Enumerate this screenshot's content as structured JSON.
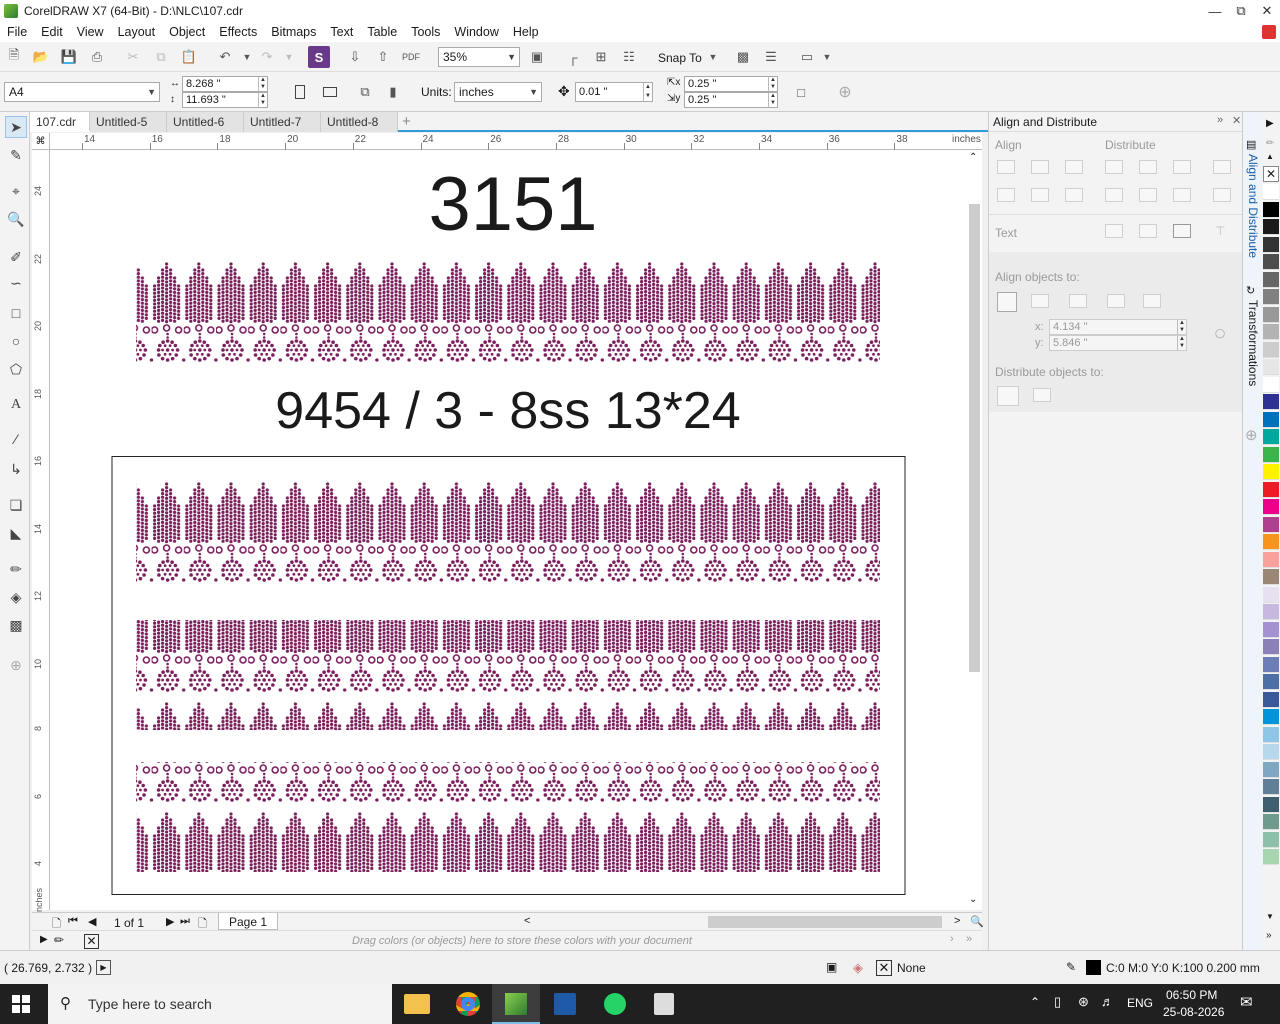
{
  "window": {
    "title": "CorelDRAW X7 (64-Bit) - D:\\NLC\\107.cdr"
  },
  "menu": [
    "File",
    "Edit",
    "View",
    "Layout",
    "Object",
    "Effects",
    "Bitmaps",
    "Text",
    "Table",
    "Tools",
    "Window",
    "Help"
  ],
  "toolbar": {
    "zoom": "35%",
    "snap_to": "Snap To"
  },
  "propbar": {
    "page_size": "A4",
    "width": "8.268 \"",
    "height": "11.693 \"",
    "units_label": "Units:",
    "units": "inches",
    "nudge": "0.01 \"",
    "dup_x": "0.25 \"",
    "dup_y": "0.25 \""
  },
  "doc_tabs": [
    "107.cdr",
    "Untitled-5",
    "Untitled-6",
    "Untitled-7",
    "Untitled-8"
  ],
  "ruler": {
    "h_ticks": [
      "14",
      "16",
      "18",
      "20",
      "22",
      "24",
      "26",
      "28",
      "30",
      "32",
      "34",
      "36",
      "38"
    ],
    "h_unit": "inches",
    "v_ticks": [
      "24",
      "22",
      "20",
      "18",
      "16",
      "14",
      "12",
      "10",
      "8",
      "6",
      "4"
    ],
    "v_unit": "inches"
  },
  "canvas": {
    "heading1": "3151",
    "heading2": "9454 / 3 - 8ss 13*24",
    "pattern_color": "#7a1f5c"
  },
  "pages": {
    "count": "1 of 1",
    "current_tab": "Page 1"
  },
  "palette_hint": "Drag colors (or objects) here to store these colors with your document",
  "docker": {
    "title": "Align and Distribute",
    "align": "Align",
    "distribute": "Distribute",
    "text": "Text",
    "align_objects_to": "Align objects to:",
    "x_label": "x:",
    "x_value": "4.134 \"",
    "y_label": "y:",
    "y_value": "5.846 \"",
    "distribute_objects_to": "Distribute objects to:"
  },
  "vtabs": [
    "Align and Distribute",
    "Transformations"
  ],
  "color_palette": [
    "#ffffff",
    "#000000",
    "#1a1a1a",
    "#333333",
    "#4d4d4d",
    "#666666",
    "#808080",
    "#999999",
    "#b3b3b3",
    "#cccccc",
    "#e6e6e6",
    "#ffffff",
    "#2e3192",
    "#0071bc",
    "#00a99d",
    "#39b54a",
    "#fff200",
    "#ed1c24",
    "#ec008c",
    "#b0408f",
    "#f7941d",
    "#f9a19a",
    "#998675",
    "#e6e0f0",
    "#c7b8e0",
    "#a491d1",
    "#8b80b8",
    "#6d7db8",
    "#4c6fa6",
    "#3b5998",
    "#0095da",
    "#8fc6e8",
    "#b7d7ea",
    "#7fa7c2",
    "#5e7f95",
    "#3e5f70",
    "#6f9b8f",
    "#8cc0a8",
    "#a8d5b0"
  ],
  "status": {
    "coords": "( 26.769, 2.732 )",
    "fill": "None",
    "outline": "C:0 M:0 Y:0 K:100  0.200 mm"
  },
  "taskbar": {
    "search_placeholder": "Type here to search",
    "lang": "ENG",
    "time": "06:50 PM",
    "date": "25-08-2026"
  }
}
